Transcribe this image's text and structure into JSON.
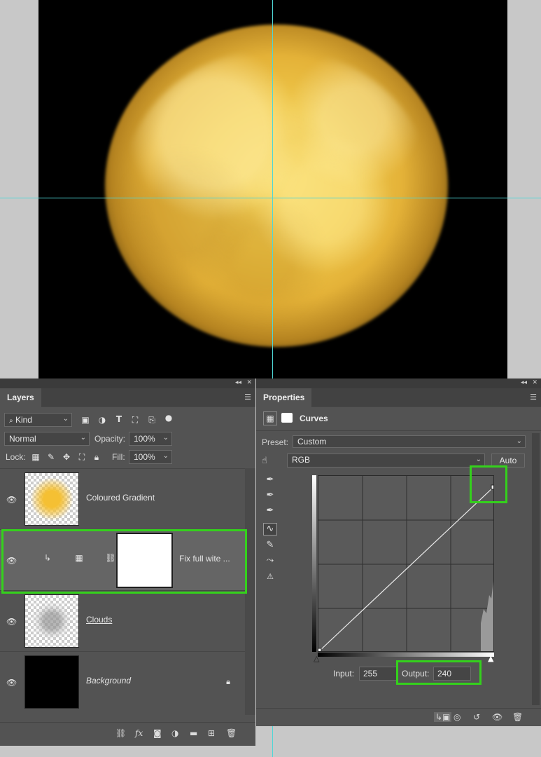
{
  "layers_panel": {
    "tab": "Layers",
    "kind_filter": "Kind",
    "blend_mode": "Normal",
    "opacity_label": "Opacity:",
    "opacity_value": "100%",
    "lock_label": "Lock:",
    "fill_label": "Fill:",
    "fill_value": "100%",
    "layers": [
      {
        "name": "Coloured Gradient",
        "visible": true
      },
      {
        "name": "Fix full wite ...",
        "visible": true,
        "selected": true,
        "type": "curves-adjustment"
      },
      {
        "name": "Clouds",
        "visible": true
      },
      {
        "name": "Background",
        "visible": true,
        "locked": true
      }
    ]
  },
  "properties_panel": {
    "tab": "Properties",
    "adjustment": "Curves",
    "preset_label": "Preset:",
    "preset_value": "Custom",
    "channel": "RGB",
    "auto_button": "Auto",
    "input_label": "Input:",
    "input_value": "255",
    "output_label": "Output:",
    "output_value": "240"
  },
  "colors": {
    "panel_bg": "#535353",
    "highlight": "#34d11c",
    "guide": "#4fd6d6",
    "gradient_orange": "#f5c033"
  }
}
